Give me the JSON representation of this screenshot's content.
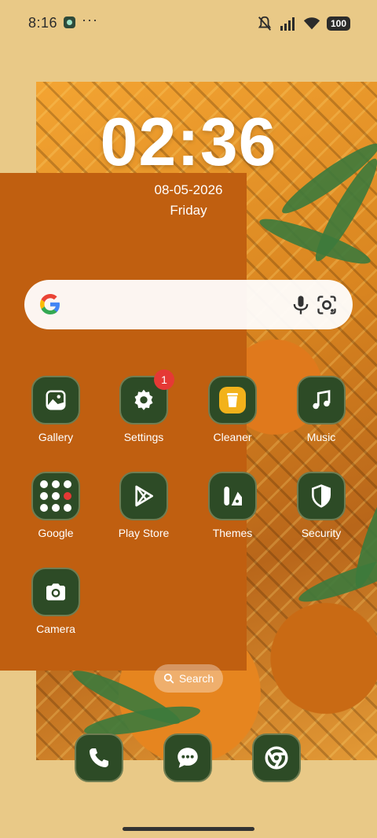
{
  "status_bar": {
    "time": "8:16",
    "more": "···",
    "battery": "100",
    "icons": [
      "app-notification-icon",
      "mute-icon",
      "signal-icon",
      "wifi-icon",
      "battery-icon"
    ]
  },
  "lockscreen": {
    "clock": "02:36",
    "date": "08-05-2026",
    "day": "Friday"
  },
  "google_search": {
    "icons": [
      "google-logo",
      "mic-icon",
      "lens-icon"
    ]
  },
  "apps": [
    {
      "label": "Gallery",
      "icon": "gallery-icon"
    },
    {
      "label": "Settings",
      "icon": "gear-icon",
      "badge": "1"
    },
    {
      "label": "Cleaner",
      "icon": "trash-icon"
    },
    {
      "label": "Music",
      "icon": "music-note-icon"
    },
    {
      "label": "Google",
      "icon": "google-folder-icon"
    },
    {
      "label": "Play Store",
      "icon": "play-store-icon"
    },
    {
      "label": "Themes",
      "icon": "themes-icon"
    },
    {
      "label": "Security",
      "icon": "shield-icon"
    },
    {
      "label": "Camera",
      "icon": "camera-icon"
    }
  ],
  "search_pill": {
    "label": "Search"
  },
  "dock": {
    "icons": [
      "phone-icon",
      "messages-icon",
      "chrome-icon"
    ]
  },
  "colors": {
    "panel": "#c05f10",
    "background": "#e9c987",
    "icon_bg": "#2d4b26",
    "badge": "#e53935"
  }
}
